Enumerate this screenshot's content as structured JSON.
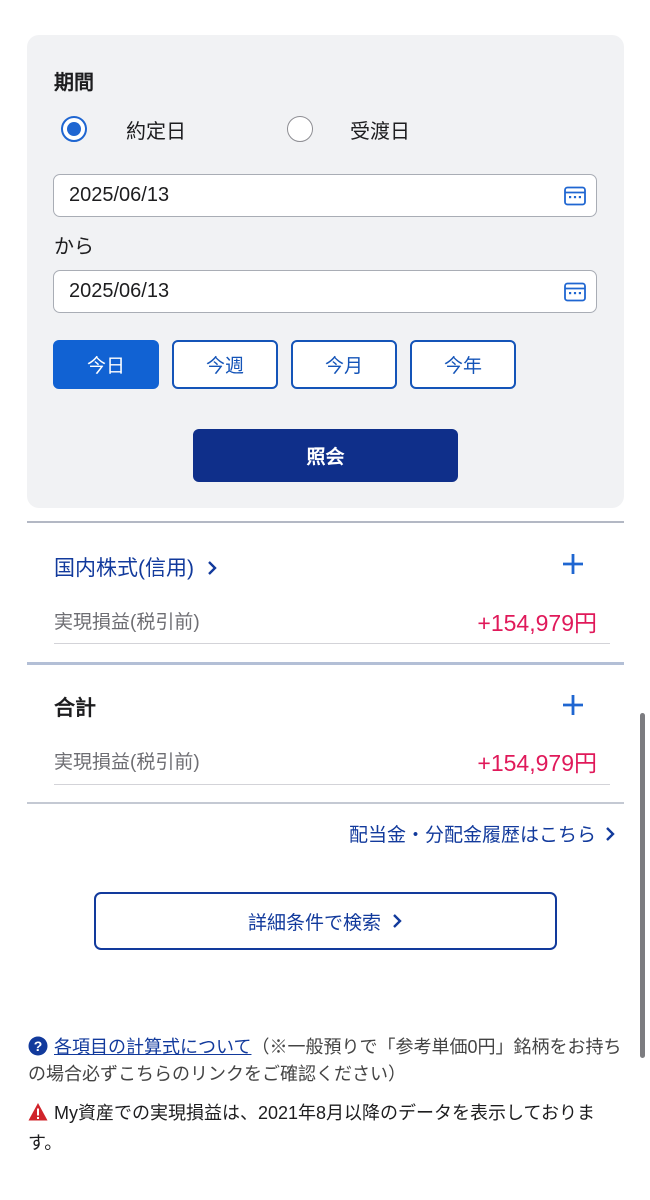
{
  "period": {
    "label": "期間",
    "radios": [
      {
        "label": "約定日",
        "checked": true
      },
      {
        "label": "受渡日",
        "checked": false
      }
    ],
    "from_date": "2025/06/13",
    "separator": "から",
    "to_date": "2025/06/13",
    "quick_ranges": [
      {
        "label": "今日",
        "active": true
      },
      {
        "label": "今週",
        "active": false
      },
      {
        "label": "今月",
        "active": false
      },
      {
        "label": "今年",
        "active": false
      }
    ],
    "inquiry_label": "照会"
  },
  "sections": [
    {
      "title": "国内株式(信用)",
      "row_label": "実現損益(税引前)",
      "row_value": "+154,979円"
    },
    {
      "title": "合計",
      "row_label": "実現損益(税引前)",
      "row_value": "+154,979円"
    }
  ],
  "dividend_link": "配当金・分配金履歴はこちら",
  "detail_search_label": "詳細条件で検索",
  "notes": {
    "calc_link": "各項目の計算式について",
    "calc_note": "（※一般預りで「参考単価0円」銘柄をお持ちの場合必ずこちらのリンクをご確認ください）",
    "warning": "My資産での実現損益は、2021年8月以降のデータを表示しております。"
  },
  "colors": {
    "accent": "#1162d3",
    "navy": "#0f2f8a",
    "link": "#123a9c",
    "profit": "#e0195a"
  },
  "icons": {
    "calendar": "calendar-icon",
    "plus": "plus-icon",
    "chevron": "chevron-right-icon",
    "help": "help-circle-icon",
    "warning": "warning-icon"
  }
}
